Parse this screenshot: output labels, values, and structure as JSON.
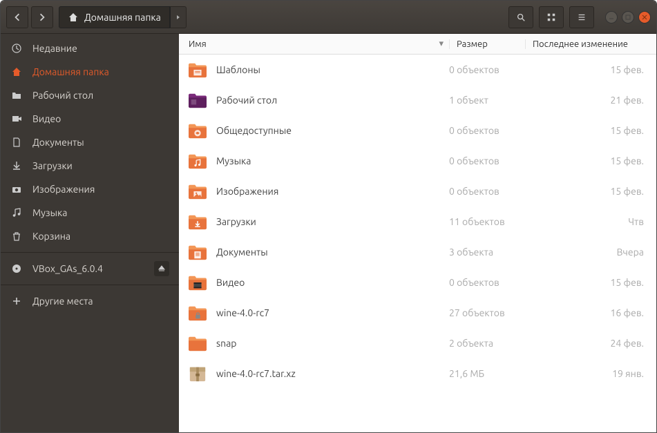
{
  "titlebar": {
    "breadcrumb": "Домашняя папка"
  },
  "sidebar": {
    "items": [
      {
        "id": "recent",
        "label": "Недавние"
      },
      {
        "id": "home",
        "label": "Домашняя папка"
      },
      {
        "id": "desktop",
        "label": "Рабочий стол"
      },
      {
        "id": "videos",
        "label": "Видео"
      },
      {
        "id": "documents",
        "label": "Документы"
      },
      {
        "id": "downloads",
        "label": "Загрузки"
      },
      {
        "id": "pictures",
        "label": "Изображения"
      },
      {
        "id": "music",
        "label": "Музыка"
      },
      {
        "id": "trash",
        "label": "Корзина"
      }
    ],
    "mount": {
      "label": "VBox_GAs_6.0.4"
    },
    "other": {
      "label": "Другие места"
    }
  },
  "columns": {
    "name": "Имя",
    "size": "Размер",
    "modified": "Последнее изменение"
  },
  "files": [
    {
      "icon": "folder-templates",
      "name": "Шаблоны",
      "size": "0 объектов",
      "modified": "15 фев."
    },
    {
      "icon": "folder-desktop",
      "name": "Рабочий стол",
      "size": "1 объект",
      "modified": "21 фев."
    },
    {
      "icon": "folder-public",
      "name": "Общедоступные",
      "size": "0 объектов",
      "modified": "15 фев."
    },
    {
      "icon": "folder-music",
      "name": "Музыка",
      "size": "0 объектов",
      "modified": "15 фев."
    },
    {
      "icon": "folder-pictures",
      "name": "Изображения",
      "size": "0 объектов",
      "modified": "15 фев."
    },
    {
      "icon": "folder-downloads",
      "name": "Загрузки",
      "size": "11 объектов",
      "modified": "Чтв"
    },
    {
      "icon": "folder-documents",
      "name": "Документы",
      "size": "3 объекта",
      "modified": "Вчера"
    },
    {
      "icon": "folder-videos",
      "name": "Видео",
      "size": "0 объектов",
      "modified": "15 фев."
    },
    {
      "icon": "folder-locked",
      "name": "wine-4.0-rc7",
      "size": "27 объектов",
      "modified": "16 фев."
    },
    {
      "icon": "folder",
      "name": "snap",
      "size": "2 объекта",
      "modified": "24 фев."
    },
    {
      "icon": "archive",
      "name": "wine-4.0-rc7.tar.xz",
      "size": "21,6 МБ",
      "modified": "19 янв."
    }
  ]
}
